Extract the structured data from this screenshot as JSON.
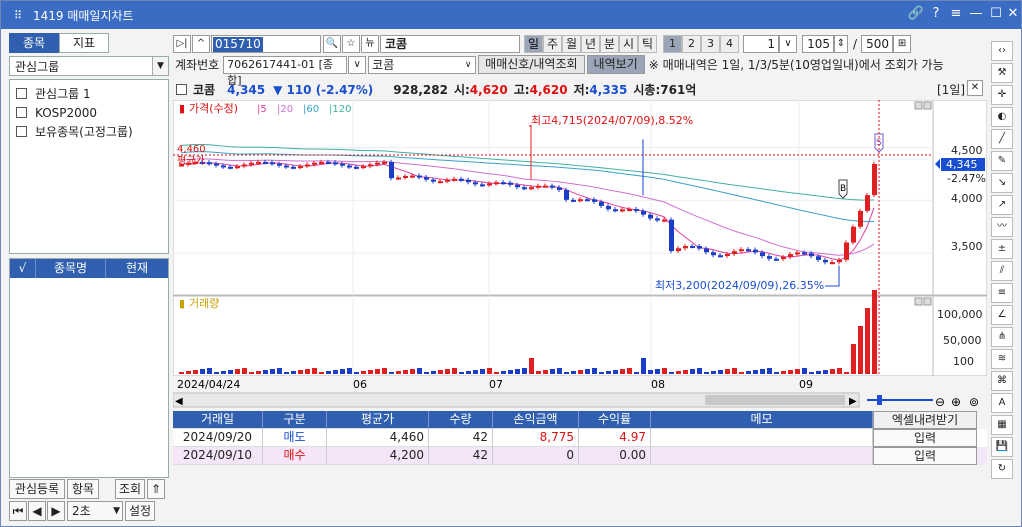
{
  "window": {
    "title": "1419 매매일지차트"
  },
  "left": {
    "tabs": [
      "종목",
      "지표"
    ],
    "group_select": "관심그룹",
    "groups": [
      "관심그룹 1",
      "KOSP2000",
      "보유종목(고정그룹)"
    ],
    "grid_headers": [
      "√",
      "종목명",
      "현재"
    ],
    "buttons": {
      "register": "관심등록",
      "item": "항목",
      "query": "조회",
      "interval": "2초",
      "settings": "설정"
    }
  },
  "toolbar": {
    "code": "015710",
    "name": "코콤",
    "periods": [
      "일",
      "주",
      "월",
      "년",
      "분",
      "시",
      "틱"
    ],
    "active_period": "일",
    "nums": [
      "1",
      "2",
      "3",
      "4"
    ],
    "active_num": "1",
    "multiplier": "1",
    "count": "105",
    "total": "500"
  },
  "account": {
    "label": "계좌번호",
    "number": "7062617441-01 [종합]",
    "stock": "코콤",
    "signal_button": "매매신호/내역조회",
    "history_button": "내역보기",
    "notice": "※ 매매내역은 1일, 1/3/5분(10영업일내)에서 조회가 가능"
  },
  "quote": {
    "name": "코콤",
    "price": "4,345",
    "change": "▼ 110 (-2.47%)",
    "volume": "928,282",
    "open_label": "시:",
    "open": "4,620",
    "high_label": "고:",
    "high": "4,620",
    "low_label": "저:",
    "low": "4,335",
    "mcap": "시총:761억",
    "period_tag": "[1일]"
  },
  "chart": {
    "price_legend": "가격(수정)",
    "ma": [
      "5",
      "20",
      "60",
      "120"
    ],
    "ma_colors": [
      "#e040a0",
      "#d070d0",
      "#3aa0c8",
      "#40b0a0"
    ],
    "high_note": "최고4,715(2024/07/09),8.52%",
    "low_note": "최저3,200(2024/09/09),26.35%",
    "avg_price": "4,460",
    "avg_label": "평균가",
    "current_price": "4,345",
    "current_change": "-2.47%",
    "price_ticks": [
      "4,500",
      "4,000",
      "3,500"
    ],
    "volume_legend": "거래량",
    "volume_ticks": [
      "100,000",
      "50,000",
      "100"
    ],
    "x_labels": [
      "2024/04/24",
      "06",
      "07",
      "08",
      "09"
    ],
    "buy_marker": "B",
    "sell_marker": "S"
  },
  "chart_data": {
    "type": "candlestick",
    "ylim": [
      3150,
      4800
    ],
    "high": {
      "value": 4715,
      "date": "2024/07/09"
    },
    "low": {
      "value": 3200,
      "date": "2024/09/09"
    },
    "last": 4345,
    "avg_price": 4460
  },
  "trades": {
    "headers": [
      "거래일",
      "구분",
      "평균가",
      "수량",
      "손익금액",
      "수익률",
      "메모"
    ],
    "excel_button": "엑셀내려받기",
    "rows": [
      {
        "date": "2024/09/20",
        "type": "매도",
        "avg": "4,460",
        "qty": "42",
        "pnl": "8,775",
        "ret": "4.97",
        "memo": "",
        "btn": "입력"
      },
      {
        "date": "2024/09/10",
        "type": "매수",
        "avg": "4,200",
        "qty": "42",
        "pnl": "0",
        "ret": "0.00",
        "memo": "",
        "btn": "입력"
      }
    ]
  }
}
